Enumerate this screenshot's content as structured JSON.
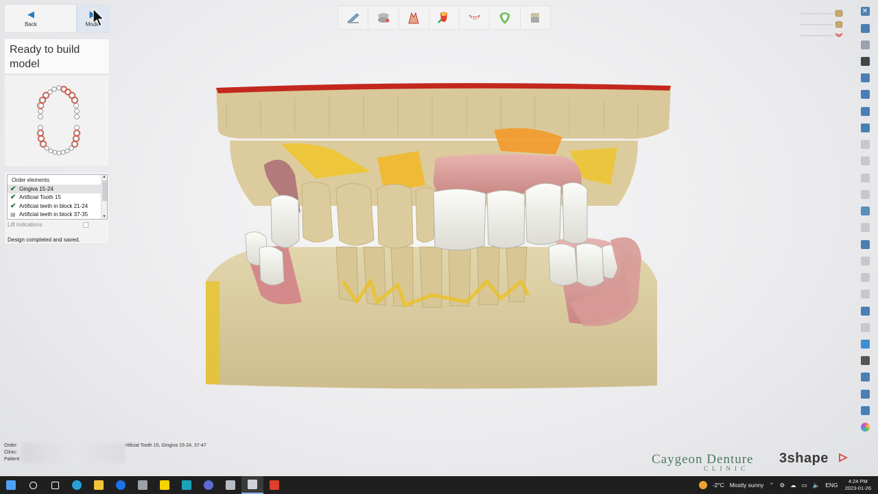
{
  "nav": {
    "back_label": "Back",
    "model_label": "Model"
  },
  "status": {
    "title": "Ready to build model"
  },
  "order_elements": {
    "header": "Order elements",
    "items": [
      {
        "label": "Gingiva 15-24",
        "state": "checked",
        "selected": true
      },
      {
        "label": "Artificial Tooth 15",
        "state": "checked",
        "selected": false
      },
      {
        "label": "Artificial teeth in block 21-24",
        "state": "checked",
        "selected": false
      },
      {
        "label": "Artificial teeth in block 37-35",
        "state": "document",
        "selected": false
      }
    ],
    "lift_indications_label": "Lift indications",
    "design_message": "Design completed and saved."
  },
  "toolbar": {
    "tools": [
      {
        "icon": "scalpel-tool-icon"
      },
      {
        "icon": "articulator-tool-icon"
      },
      {
        "icon": "teeth-setup-tool-icon"
      },
      {
        "icon": "gingiva-color-tool-icon"
      },
      {
        "icon": "gum-tool-icon"
      },
      {
        "icon": "tooth-library-tool-icon"
      },
      {
        "icon": "model-base-tool-icon"
      }
    ]
  },
  "visibility_sliders": [
    {
      "icon": "upper-model-visibility-icon",
      "color": "#c9a86a"
    },
    {
      "icon": "teeth-visibility-icon",
      "color": "#c9a86a"
    },
    {
      "icon": "gingiva-visibility-icon",
      "color": "#d9534f"
    }
  ],
  "right_sidebar": [
    {
      "icon": "close-icon",
      "color": "#4a7fb5"
    },
    {
      "icon": "fullscreen-icon",
      "color": "#4a7fb5"
    },
    {
      "icon": "occlusion-view-icon",
      "color": "#9aa3ad"
    },
    {
      "icon": "tutorial-cap-icon",
      "color": "#444444",
      "active": true
    },
    {
      "icon": "view-front-icon",
      "color": "#4a7fb5"
    },
    {
      "icon": "view-back-icon",
      "color": "#4a7fb5"
    },
    {
      "icon": "view-side-icon",
      "color": "#4a7fb5"
    },
    {
      "icon": "view-top-icon",
      "color": "#4a7fb5"
    },
    {
      "icon": "disabled-tool-icon",
      "color": "#c8c8cc"
    },
    {
      "icon": "disabled-tool-icon",
      "color": "#c8c8cc"
    },
    {
      "icon": "disabled-tool-icon",
      "color": "#c8c8cc"
    },
    {
      "icon": "disabled-tool-icon",
      "color": "#c8c8cc"
    },
    {
      "icon": "model-preview-icon",
      "color": "#5a8fb8"
    },
    {
      "icon": "disabled-tool-icon",
      "color": "#c8c8cc"
    },
    {
      "icon": "jaw-section-icon",
      "color": "#4a7fb5"
    },
    {
      "icon": "disabled-tool-icon",
      "color": "#c8c8cc"
    },
    {
      "icon": "disabled-tool-icon",
      "color": "#c8c8cc"
    },
    {
      "icon": "disabled-tool-icon",
      "color": "#c8c8cc"
    },
    {
      "icon": "color-map-icon",
      "color": "#4a7fb5"
    },
    {
      "icon": "disabled-tool-icon",
      "color": "#c8c8cc"
    },
    {
      "icon": "chat-bubble-icon",
      "color": "#3d8fd1"
    },
    {
      "icon": "tooth-outline-icon",
      "color": "#555555"
    },
    {
      "icon": "measure-icon",
      "color": "#4a7fb5"
    },
    {
      "icon": "ruler-icon",
      "color": "#4a7fb5"
    },
    {
      "icon": "print-preview-icon",
      "color": "#4a7fb5",
      "active": true
    },
    {
      "icon": "color-wheel-icon",
      "color": "#e05a9a"
    }
  ],
  "order_info": {
    "order_label": "Order:",
    "clinic_label": "Clinic:",
    "patient_label": "Patient:",
    "elements_summary": "rtificial Tooth 15, Gingiva 15-24, 37-47"
  },
  "brand": {
    "clinic_name": "Caygeon Denture",
    "clinic_sub": "CLINIC",
    "vendor": "3shape"
  },
  "taskbar": {
    "weather_temp": "-2°C",
    "weather_text": "Mostly sunny",
    "language": "ENG",
    "time": "4:24 PM",
    "date": "2023-01-26",
    "apps": [
      {
        "icon": "windows-start-icon",
        "color": "#4ea1f3"
      },
      {
        "icon": "search-icon",
        "color": "#ffffff"
      },
      {
        "icon": "task-view-icon",
        "color": "#ffffff"
      },
      {
        "icon": "edge-browser-icon",
        "color": "#2b9fd8"
      },
      {
        "icon": "file-explorer-icon",
        "color": "#f3c13a"
      },
      {
        "icon": "teamviewer-icon",
        "color": "#1a73e8"
      },
      {
        "icon": "screenshot-tool-icon",
        "color": "#9aa0a6"
      },
      {
        "icon": "sticky-notes-icon",
        "color": "#f5d300"
      },
      {
        "icon": "c-app-icon",
        "color": "#1aa3b8"
      },
      {
        "icon": "media-player-icon",
        "color": "#5b6ad6"
      },
      {
        "icon": "dental-system-icon",
        "color": "#b5bcc4"
      },
      {
        "icon": "denture-design-icon",
        "color": "#d0d4d8",
        "active": true
      },
      {
        "icon": "camtasia-icon",
        "color": "#e0402a"
      }
    ]
  }
}
